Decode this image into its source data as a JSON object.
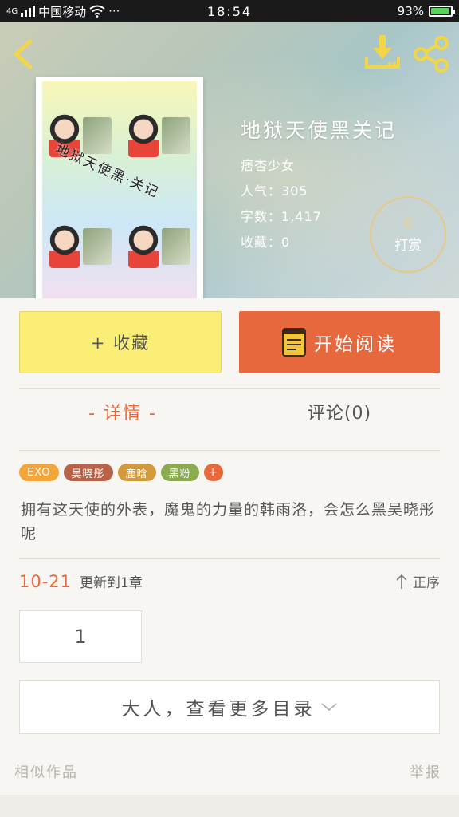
{
  "status_bar": {
    "network": "4G",
    "carrier": "中国移动",
    "more": "···",
    "time": "18:54",
    "battery": "93%",
    "battery_level": 0.93
  },
  "header": {
    "back_icon": "chevron-left-icon",
    "download_icon": "download-icon",
    "share_icon": "share-icon"
  },
  "cover": {
    "title_text": "地狱天使黑·关记"
  },
  "book": {
    "title": "地狱天使黑关记",
    "author": "痞杏少女",
    "popularity_label": "人气：",
    "popularity": "305",
    "word_count_label": "字数：",
    "word_count": "1,417",
    "favorites_label": "收藏：",
    "favorites": "0"
  },
  "tip": {
    "count": "0",
    "label": "打赏"
  },
  "actions": {
    "favorite_label": "+ 收藏",
    "read_label": "开始阅读"
  },
  "tabs": {
    "details_label": "- 详情 -",
    "comments_label": "评论(0)"
  },
  "tags": [
    {
      "label": "EXO",
      "color": "#f2a63a"
    },
    {
      "label": "吴晓彤",
      "color": "#b8624a"
    },
    {
      "label": "鹿晗",
      "color": "#d49a3a"
    },
    {
      "label": "黑粉",
      "color": "#8aac4e"
    },
    {
      "label": "+",
      "color": "#e8683d"
    }
  ],
  "description": "拥有这天使的外表，魔鬼的力量的韩雨洛，会怎么黑吴晓彤呢",
  "update": {
    "date": "10-21",
    "text": "更新到1章",
    "sort_label": "正序"
  },
  "chapters": [
    "1"
  ],
  "more_catalog_label": "大人，查看更多目录",
  "footer": {
    "similar_label": "相似作品",
    "report_label": "举报"
  },
  "colors": {
    "accent": "#e8683d",
    "favorite_button": "#fbee76",
    "tip_border": "#e8c98a"
  }
}
